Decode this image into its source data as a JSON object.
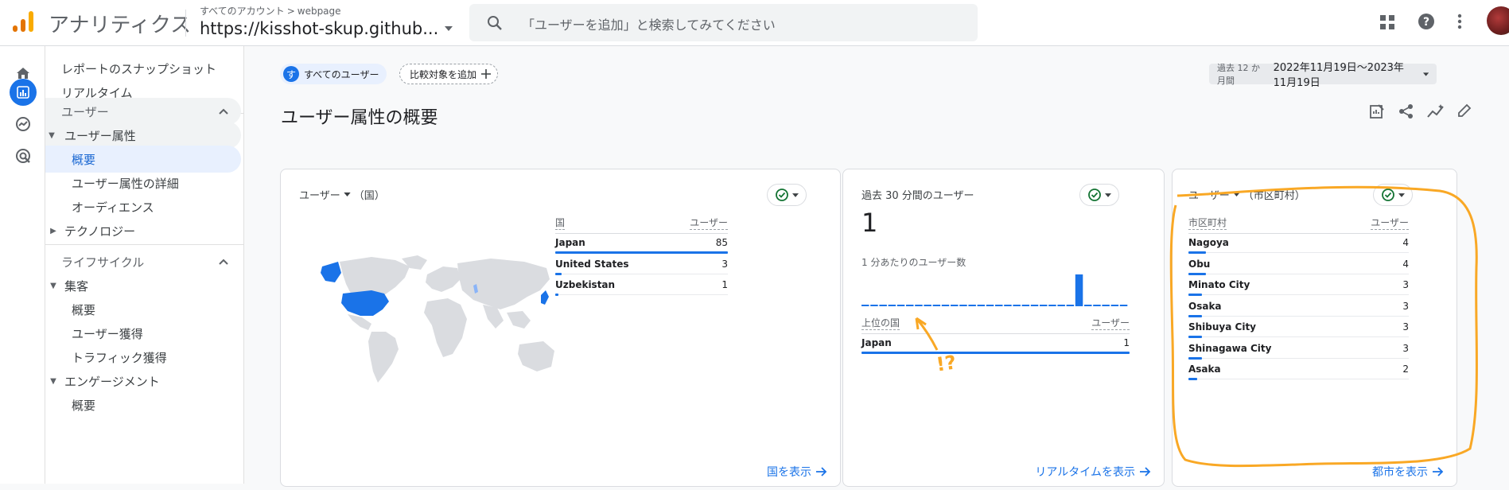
{
  "header": {
    "app_title": "アナリティクス",
    "account_crumb": "すべてのアカウント",
    "crumb_sep": ">",
    "account_name": "webpage",
    "property_name": "https://kisshot-skup.github...",
    "search_placeholder": "「ユーザーを追加」と検索してみてください",
    "icons": [
      "apps-icon",
      "help-icon",
      "more-vert-icon"
    ]
  },
  "rail": [
    "home-icon",
    "reports-icon",
    "explore-icon",
    "advertising-icon"
  ],
  "nav": {
    "items": [
      {
        "label": "レポートのスナップショット"
      },
      {
        "label": "リアルタイム"
      }
    ],
    "sections": [
      {
        "label": "ユーザー"
      },
      {
        "label": "ユーザー属性"
      },
      {
        "label": "概要"
      },
      {
        "label": "ユーザー属性の詳細"
      },
      {
        "label": "オーディエンス"
      },
      {
        "label": "テクノロジー"
      },
      {
        "label": "ライフサイクル"
      },
      {
        "label": "集客"
      },
      {
        "label": "概要"
      },
      {
        "label": "ユーザー獲得"
      },
      {
        "label": "トラフィック獲得"
      },
      {
        "label": "エンゲージメント"
      },
      {
        "label": "概要"
      }
    ]
  },
  "toolbar": {
    "segment_initial": "す",
    "segment_label": "すべてのユーザー",
    "compare_label": "比較対象を追加",
    "date_prefix": "過去 12 か月間",
    "date_range": "2022年11月19日～2023年11月19日"
  },
  "page": {
    "title": "ユーザー属性の概要"
  },
  "cards": {
    "country": {
      "title": "ユーザー",
      "title_suffix": "（国）",
      "col_dim": "国",
      "col_metric": "ユーザー",
      "rows": [
        {
          "name": "Japan",
          "value": "85",
          "fraction": 1.0
        },
        {
          "name": "United States",
          "value": "3",
          "fraction": 0.035
        },
        {
          "name": "Uzbekistan",
          "value": "1",
          "fraction": 0.012
        }
      ],
      "link": "国を表示"
    },
    "realtime": {
      "title": "過去 30 分間のユーザー",
      "value": "1",
      "per_minute_label": "1 分あたりのユーザー数",
      "col_dim": "上位の国",
      "col_metric": "ユーザー",
      "rows": [
        {
          "name": "Japan",
          "value": "1",
          "fraction": 1.0
        }
      ],
      "link": "リアルタイムを表示"
    },
    "city": {
      "title": "ユーザー",
      "title_suffix": "（市区町村）",
      "col_dim": "市区町村",
      "col_metric": "ユーザー",
      "rows": [
        {
          "name": "Nagoya",
          "value": "4",
          "fraction": 0.08
        },
        {
          "name": "Obu",
          "value": "4",
          "fraction": 0.08
        },
        {
          "name": "Minato City",
          "value": "3",
          "fraction": 0.06
        },
        {
          "name": "Osaka",
          "value": "3",
          "fraction": 0.06
        },
        {
          "name": "Shibuya City",
          "value": "3",
          "fraction": 0.06
        },
        {
          "name": "Shinagawa City",
          "value": "3",
          "fraction": 0.06
        },
        {
          "name": "Asaka",
          "value": "2",
          "fraction": 0.04
        }
      ],
      "link": "都市を表示"
    }
  },
  "annotation": {
    "text": "!?"
  },
  "colors": {
    "accent": "#1a73e8",
    "highlight": "#f9a825",
    "map_land": "#dadce0"
  }
}
